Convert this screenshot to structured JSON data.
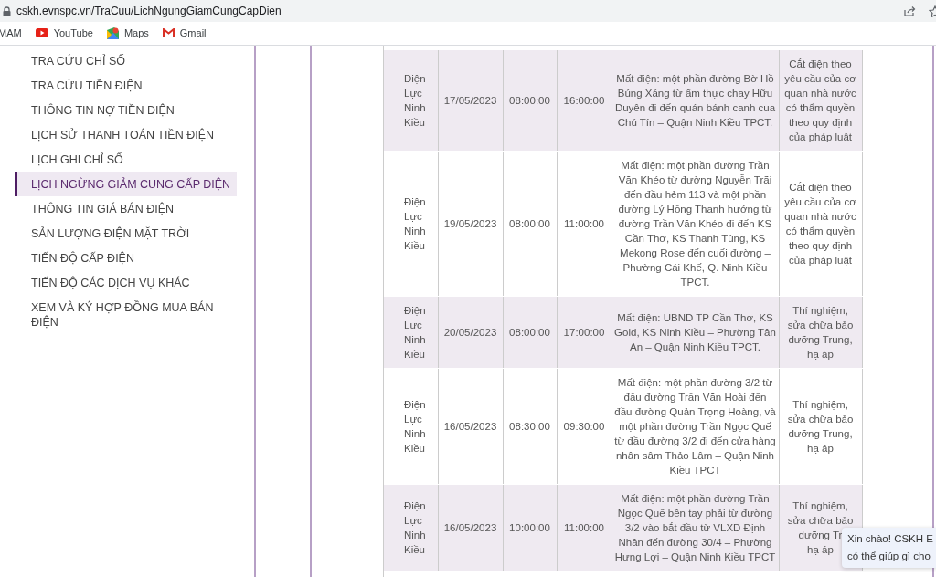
{
  "browser": {
    "url": "cskh.evnspc.vn/TraCuu/LichNgungGiamCungCapDien",
    "bookmarks": [
      {
        "label": "MAM",
        "kind": "plain"
      },
      {
        "label": "YouTube",
        "kind": "youtube"
      },
      {
        "label": "Maps",
        "kind": "maps"
      },
      {
        "label": "Gmail",
        "kind": "gmail"
      }
    ]
  },
  "sidebar": {
    "items": [
      {
        "label": "TRA CỨU CHỈ SỐ",
        "selected": false
      },
      {
        "label": "TRA CỨU TIỀN ĐIỆN",
        "selected": false
      },
      {
        "label": "THÔNG TIN NỢ TIỀN ĐIỆN",
        "selected": false
      },
      {
        "label": "LỊCH SỬ THANH TOÁN TIỀN ĐIỆN",
        "selected": false
      },
      {
        "label": "LỊCH GHI CHỈ SỐ",
        "selected": false
      },
      {
        "label": "LỊCH NGỪNG GIẢM CUNG CẤP ĐIỆN",
        "selected": true
      },
      {
        "label": "THÔNG TIN GIÁ BÁN ĐIỆN",
        "selected": false
      },
      {
        "label": "SẢN LƯỢNG ĐIỆN MẶT TRỜI",
        "selected": false
      },
      {
        "label": "TIẾN ĐỘ CẤP ĐIỆN",
        "selected": false
      },
      {
        "label": "TIẾN ĐỘ CÁC DỊCH VỤ KHÁC",
        "selected": false
      },
      {
        "label": "XEM VÀ KÝ HỢP ĐỒNG MUA BÁN ĐIỆN",
        "selected": false
      }
    ]
  },
  "table": {
    "rows": [
      {
        "cells": [
          "Điện Lực Ninh Kiều",
          "17/05/2023",
          "08:00:00",
          "16:00:00",
          "Mất điện: một phần đường Bờ Hồ Búng Xáng từ ẩm thực chay Hữu Duyên đi đến quán bánh canh cua Chú Tín – Quận Ninh Kiều TPCT.",
          "Cắt điện theo yêu cầu của cơ quan nhà nước có thẩm quyền theo quy định của pháp luật"
        ]
      },
      {
        "cells": [
          "Điện Lực Ninh Kiều",
          "19/05/2023",
          "08:00:00",
          "11:00:00",
          "Mất điện: một phần đường Trần Văn Khéo từ đường Nguyễn Trãi đến đầu hẻm 113 và một phần đường Lý Hồng Thanh hướng từ đường Trần Văn Khéo đi đến KS Cần Thơ, KS Thanh Tùng, KS Mekong Rose đến cuối đường – Phường Cái Khế, Q. Ninh Kiều TPCT.",
          "Cắt điện theo yêu cầu của cơ quan nhà nước có thẩm quyền theo quy định của pháp luật"
        ]
      },
      {
        "cells": [
          "Điện Lực Ninh Kiều",
          "20/05/2023",
          "08:00:00",
          "17:00:00",
          "Mất điện: UBND TP Cần Thơ, KS Gold, KS Ninh Kiều – Phường Tân An – Quận Ninh Kiều TPCT.",
          "Thí nghiệm, sửa chữa bảo dưỡng Trung, hạ áp"
        ]
      },
      {
        "cells": [
          "Điện Lực Ninh Kiều",
          "16/05/2023",
          "08:30:00",
          "09:30:00",
          "Mất điện: một phần đường 3/2 từ đầu đường Trần Văn Hoài đến đầu đường Quản Trọng Hoàng, và một phần đường Trần Ngọc Quế từ đầu đường 3/2 đi đến cửa hàng nhân sâm Thảo Lâm – Quận Ninh Kiều TPCT",
          "Thí nghiệm, sửa chữa bảo dưỡng Trung, hạ áp"
        ]
      },
      {
        "cells": [
          "Điện Lực Ninh Kiều",
          "16/05/2023",
          "10:00:00",
          "11:00:00",
          "Mất điện: một phần đường Trần Ngọc Quế bên tay phải từ đường 3/2 vào bắt đầu từ VLXD Định Nhân đến đường 30/4 – Phường Hưng Lợi – Quận Ninh Kiều TPCT",
          "Thí nghiệm,\nsửa chữa bảo\ndưỡng Tr\nhạ áp"
        ]
      }
    ]
  },
  "chat_bubble": {
    "lines": [
      "Xin chào! CSKH E",
      "có thể giúp gì cho"
    ]
  }
}
